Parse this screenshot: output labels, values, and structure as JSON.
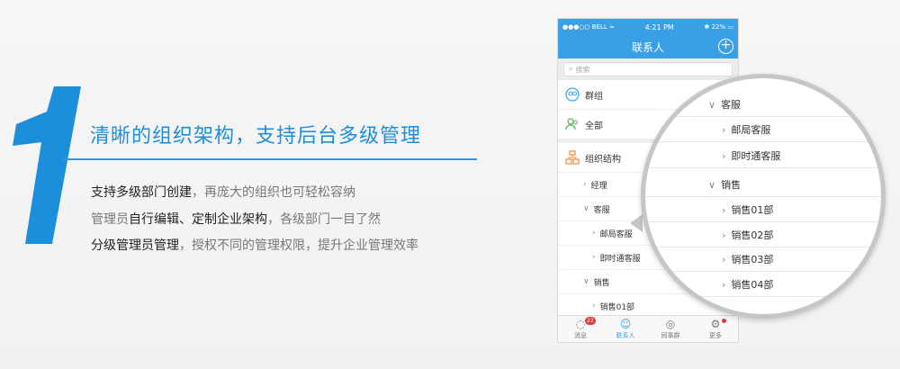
{
  "promo": {
    "number": "1",
    "headline": "清晰的组织架构，支持后台多级管理",
    "lines": [
      {
        "em": "支持多级部门创建",
        "rest": "，再庞大的组织也可轻松容纳",
        "pre": ""
      },
      {
        "pre": "管理员",
        "em": "自行编辑、定制企业架构",
        "rest": "，各级部门一目了然"
      },
      {
        "pre": "",
        "em": "分级管理员管理",
        "rest": "，授权不同的管理权限，提升企业管理效率"
      }
    ]
  },
  "phone": {
    "status": {
      "carrier": "●●●○○ BELL ≈",
      "time": "4:21 PM",
      "battery": "✱ 22% ▭"
    },
    "title": "联系人",
    "add_icon": "plus-circle-icon",
    "search_placeholder": "搜索",
    "rows": [
      {
        "label": "群组"
      },
      {
        "label": "全部"
      },
      {
        "label": "组织结构"
      }
    ],
    "subrows": [
      {
        "label": "经理",
        "chev": "›"
      },
      {
        "label": "客服",
        "chev": "∨"
      },
      {
        "label": "邮局客服",
        "chev": "›"
      },
      {
        "label": "即时通客服",
        "chev": "›"
      },
      {
        "label": "销售",
        "chev": "∨"
      },
      {
        "label": "销售01部",
        "chev": "›"
      }
    ],
    "tabs": [
      {
        "label": "消息",
        "icon": "chat-icon",
        "badge": "22"
      },
      {
        "label": "联系人",
        "icon": "contact-icon"
      },
      {
        "label": "同事群",
        "icon": "group-icon"
      },
      {
        "label": "更多",
        "icon": "gear-icon"
      }
    ]
  },
  "magnifier": {
    "rows": [
      {
        "label": "客服",
        "chev": "∨"
      },
      {
        "label": "邮局客服",
        "chev": "›"
      },
      {
        "label": "即时通客服",
        "chev": "›"
      },
      {
        "label": "销售",
        "chev": "∨"
      },
      {
        "label": "销售01部",
        "chev": "›"
      },
      {
        "label": "销售02部",
        "chev": "›"
      },
      {
        "label": "销售03部",
        "chev": "›"
      },
      {
        "label": "销售04部",
        "chev": "›"
      }
    ]
  },
  "colors": {
    "accent": "#1c8fdc",
    "nav": "#3aa0e6",
    "badge": "#e53935"
  }
}
